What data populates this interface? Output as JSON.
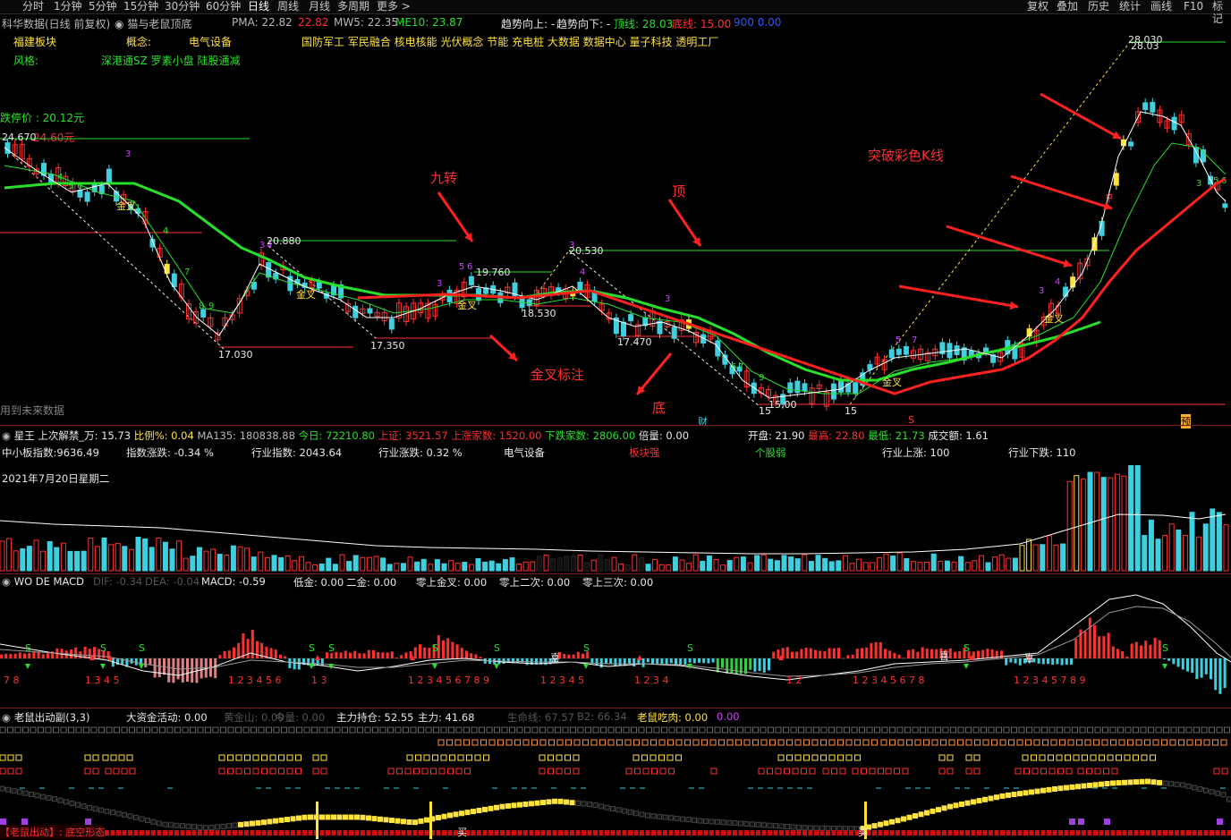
{
  "topbar": {
    "periods": [
      "分时",
      "1分钟",
      "5分钟",
      "15分钟",
      "30分钟",
      "60分钟",
      "日线",
      "周线",
      "月线",
      "多周期",
      "更多 >"
    ],
    "active_period": "日线",
    "tools": [
      "复权",
      "叠加",
      "历史",
      "统计",
      "画线",
      "F10",
      "标记"
    ]
  },
  "header": {
    "stock_name": "科华数据(日线 前复权)",
    "indicator_name": "猫与老鼠顶底",
    "pma": "PMA: 22.82",
    "pma2": "22.82",
    "mw5": "MW5: 22.35",
    "me10": "ME10: 23.87",
    "trend_up": "趋势向上: -",
    "trend_down": "趋势向下: -",
    "top_line": "顶线: 28.03",
    "bottom_line": "底线: 15.00",
    "extra": "900 0.00"
  },
  "info": {
    "sector_label": "福建板块",
    "concept_label": "概念:",
    "concept_main": "电气设备",
    "concepts": "国防军工 军民融合 核电核能 光伏概念 节能 充电桩 大数据 数据中心 量子科技 透明工厂",
    "style_label": "风格:",
    "style_value": "深港通SZ 罗素小盘 陆股通减",
    "limit_down": "跌停价 : 20.12元",
    "limit_up": "24.60元",
    "future_data": "用到未来数据"
  },
  "price_labels": {
    "p24670": "24.670",
    "p20880": "20.880",
    "p20530": "20.530",
    "p19760": "19.760",
    "p18530": "18.530",
    "p17030": "17.030",
    "p17350": "17.350",
    "p17470": "17.470",
    "p15000": "15.00",
    "p15": "15",
    "p28030": "28.030",
    "p2803": "28.03"
  },
  "annotations": {
    "jiuzhuan": "九转",
    "ding": "顶",
    "di": "底",
    "jincha_biaozhu": "金叉标注",
    "tupo": "突破彩色K线",
    "jincha": "金叉"
  },
  "markers": {
    "cai": "财",
    "s": "S",
    "yu": "预"
  },
  "quote_bar": {
    "label": "星王",
    "jiejin": "上次解禁_万: 15.73",
    "bili": "比例%: 0.04",
    "ma135": "MA135: 180838.88",
    "today": "今日: 72210.80",
    "shangzheng": "上证: 3521.57",
    "up_count": "上涨家数: 1520.00",
    "down_count": "下跌家数: 2806.00",
    "beiliang": "倍量: 0.00",
    "open": "开盘: 21.90",
    "high": "最高: 22.80",
    "low": "最低: 21.73",
    "amount": "成交额: 1.61"
  },
  "market_bar": {
    "zxb": "中小板指数:9636.49",
    "zhishu_zd": "指数涨跌:  -0.34 %",
    "hy_zhishu": "行业指数:  2043.64",
    "hy_zd": "行业涨跌:  0.32 %",
    "hy_name": "电气设备",
    "bk_strong": "板块强",
    "gg_weak": "个股弱",
    "hy_up": "行业上涨:  100",
    "hy_down": "行业下跌:  110"
  },
  "date_label": "2021年7月20日星期二",
  "macd": {
    "title": "WO DE MACD",
    "dif": "DIF: -0.34",
    "dea": "DEA: -0.04",
    "macd": "MACD: -0.59",
    "dijin": "低金: 0.00",
    "erjin": "二金: 0.00",
    "lsjc": "零上金叉: 0.00",
    "ls2": "零上二次: 0.00",
    "ls3": "零上三次: 0.00",
    "seq1": "7 8",
    "seq2": "1     3 4 5",
    "seq3": "1 2 3 4 5 6",
    "seq4": "1   3",
    "seq5": "1 2 3 4 5 6 7 8 9",
    "seq6": "1 2 3 4 5",
    "seq7": "1 2 3 4",
    "seq8": "1 2",
    "seq9": "1 2 3 4 5 6 7 8",
    "seq10": "1 2 3 4 5   7 8 9",
    "xi": "喜"
  },
  "mouse": {
    "title": "老鼠出动副(3,3)",
    "dzj": "大资金活动: 0.00",
    "hjs": "黄金山: 0.00",
    "jl": "今量: 0.00",
    "zlcc": "主力持仓: 52.55",
    "zl": "主力: 41.68",
    "smx": "生命线: 67.57",
    "b2": "B2: 66.34",
    "lsck": "老鼠吃肉: 0.00",
    "extra": "0.00",
    "bottom_tag": "【老鼠出动】: 底空形态",
    "mai": "买"
  },
  "colors": {
    "up": "#ff3030",
    "down": "#3fd0e0",
    "ma_white": "#ffffff",
    "ma_green": "#27e02a",
    "ma_red": "#ff2020",
    "yellow": "#ffe23a",
    "grid": "#7a1b1b"
  }
}
